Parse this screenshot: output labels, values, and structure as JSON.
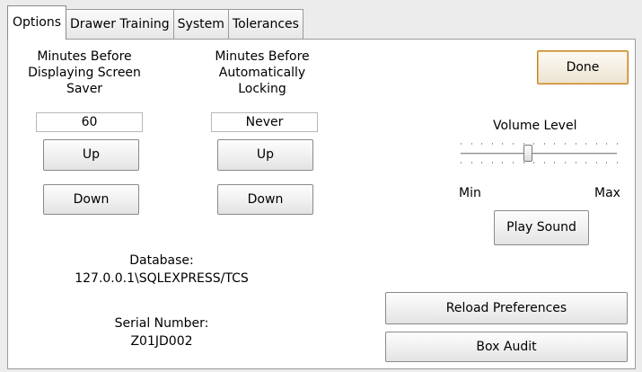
{
  "tabs": [
    {
      "label": "Options",
      "active": true
    },
    {
      "label": "Drawer Training",
      "active": false
    },
    {
      "label": "System",
      "active": false
    },
    {
      "label": "Tolerances",
      "active": false
    }
  ],
  "screen_saver": {
    "label": "Minutes Before\nDisplaying Screen\nSaver",
    "value": "60",
    "up_label": "Up",
    "down_label": "Down"
  },
  "auto_lock": {
    "label": "Minutes Before\nAutomatically\nLocking",
    "value": "Never",
    "up_label": "Up",
    "down_label": "Down"
  },
  "done_label": "Done",
  "volume": {
    "label": "Volume Level",
    "min_label": "Min",
    "max_label": "Max",
    "level_fraction": 0.43,
    "play_label": "Play Sound"
  },
  "database": {
    "label": "Database:",
    "value": "127.0.0.1\\SQLEXPRESS/TCS"
  },
  "serial": {
    "label": "Serial Number:",
    "value": "Z01JD002"
  },
  "reload_label": "Reload Preferences",
  "box_audit_label": "Box Audit"
}
